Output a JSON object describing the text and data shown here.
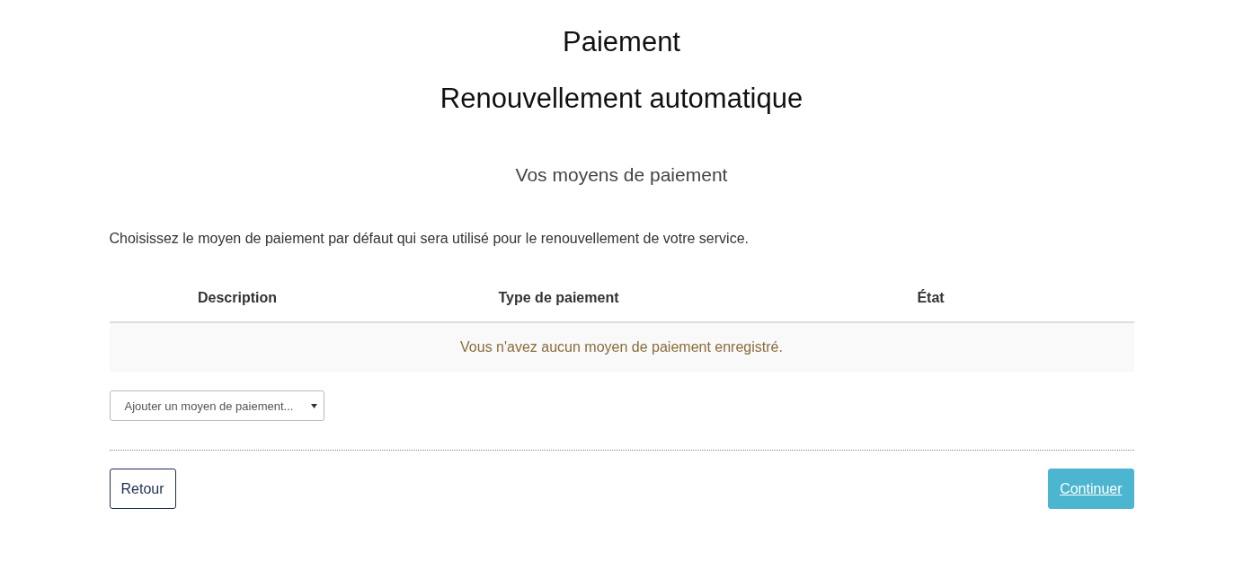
{
  "headings": {
    "title": "Paiement",
    "subtitle": "Renouvellement automatique",
    "section": "Vos moyens de paiement"
  },
  "intro": "Choisissez le moyen de paiement par défaut qui sera utilisé pour le renouvellement de votre service.",
  "table": {
    "columns": [
      "Description",
      "Type de paiement",
      "État"
    ],
    "empty_message": "Vous n'avez aucun moyen de paiement enregistré."
  },
  "add_payment_select": {
    "value": "Ajouter un moyen de paiement..."
  },
  "buttons": [
    {
      "kind": "back",
      "label": "Retour",
      "disabled": false
    },
    {
      "kind": "continue",
      "label": "Continuer",
      "disabled": true
    }
  ]
}
